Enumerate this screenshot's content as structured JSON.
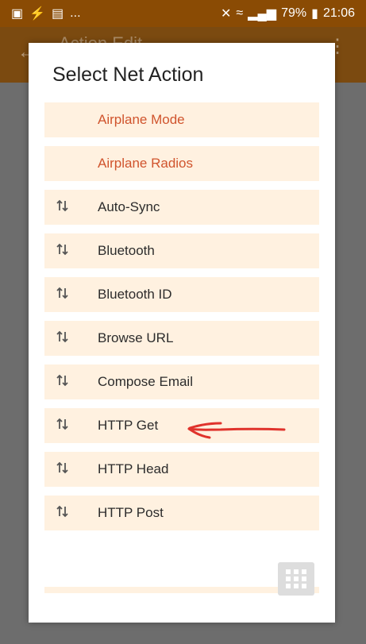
{
  "status_bar": {
    "left_icons": [
      "image-icon",
      "bolt-icon",
      "mail-icon"
    ],
    "ellipsis": "...",
    "battery": "79%",
    "time": "21:06"
  },
  "app": {
    "title": "Action Edit"
  },
  "dialog": {
    "title": "Select Net Action",
    "items": [
      {
        "label": "Airplane Mode",
        "icon": "",
        "highlight": true
      },
      {
        "label": "Airplane Radios",
        "icon": "",
        "highlight": true
      },
      {
        "label": "Auto-Sync",
        "icon": "updown-arrow-icon",
        "highlight": false
      },
      {
        "label": "Bluetooth",
        "icon": "updown-arrow-icon",
        "highlight": false
      },
      {
        "label": "Bluetooth ID",
        "icon": "updown-arrow-icon",
        "highlight": false
      },
      {
        "label": "Browse URL",
        "icon": "updown-arrow-icon",
        "highlight": false
      },
      {
        "label": "Compose Email",
        "icon": "updown-arrow-icon",
        "highlight": false
      },
      {
        "label": "HTTP Get",
        "icon": "updown-arrow-icon",
        "highlight": false
      },
      {
        "label": "HTTP Head",
        "icon": "updown-arrow-icon",
        "highlight": false
      },
      {
        "label": "HTTP Post",
        "icon": "updown-arrow-icon",
        "highlight": false
      }
    ],
    "grid_button_icon": "grid-icon"
  },
  "colors": {
    "status_bar": "#8a4b04",
    "toolbar": "#7b4a10",
    "overlay": "#6d6d6d",
    "item_bg": "#fff1e0",
    "highlight_text": "#d0542d",
    "annotation": "#e0332c"
  }
}
